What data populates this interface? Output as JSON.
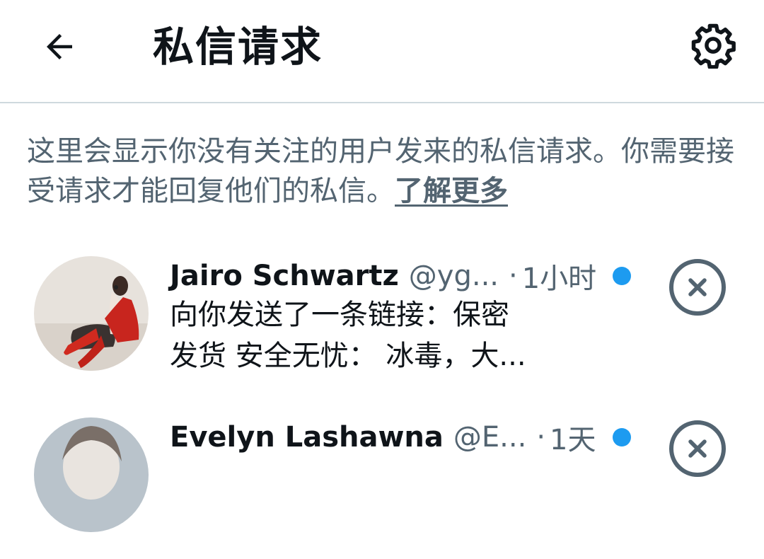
{
  "header": {
    "back_icon": "arrow-left-icon",
    "title": "私信请求",
    "settings_icon": "gear-icon"
  },
  "info": {
    "text": "这里会显示你没有关注的用户发来的私信请求。你需要接受请求才能回复他们的私信。",
    "link": "了解更多"
  },
  "requests": [
    {
      "name": "Jairo Schwartz",
      "handle": "@yg...",
      "separator": "·",
      "time": "1小时",
      "preview_line1": "向你发送了一条链接：保密",
      "preview_line2": "发货 安全无忧： 冰毒，大...",
      "unread": true,
      "dismiss_icon": "close-circle-icon"
    },
    {
      "name": "Evelyn Lashawna",
      "handle": "@E...",
      "separator": "·",
      "time": "1天",
      "unread": true,
      "dismiss_icon": "close-circle-icon"
    }
  ],
  "colors": {
    "accent": "#1d9bf0",
    "text_primary": "#0f1419",
    "text_secondary": "#536471",
    "divider": "#cfd9de"
  }
}
